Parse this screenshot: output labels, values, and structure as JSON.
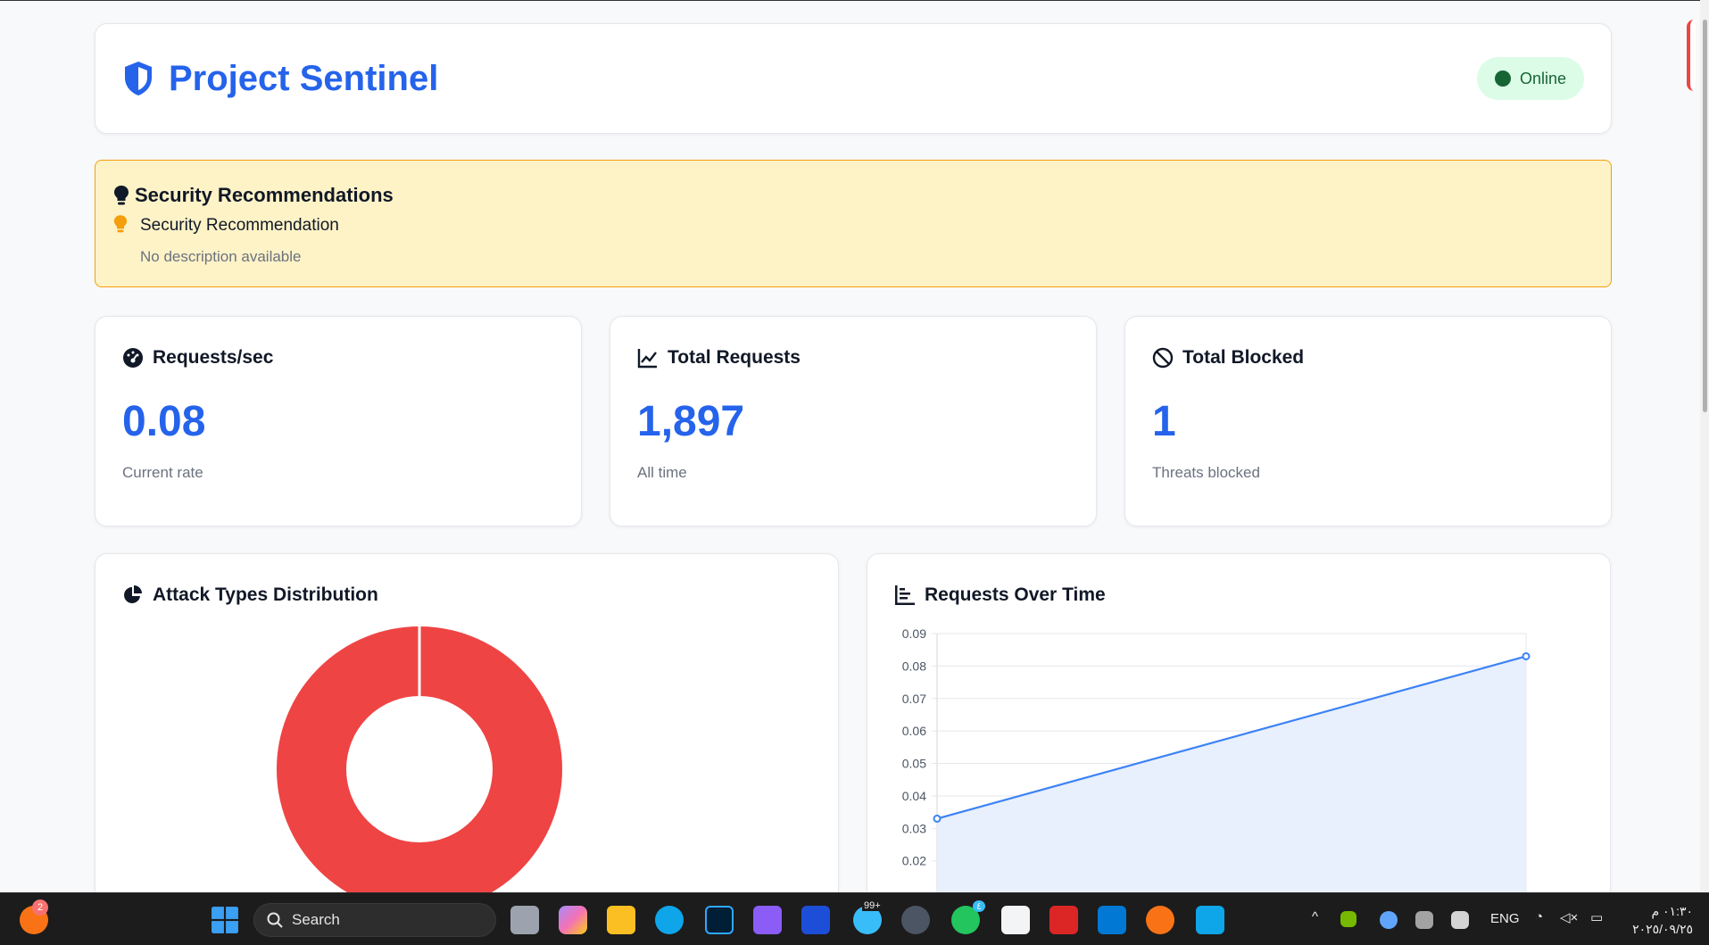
{
  "header": {
    "title": "Project Sentinel",
    "status": "Online"
  },
  "recommendations": {
    "title": "Security Recommendations",
    "items": [
      {
        "title": "Security Recommendation",
        "description": "No description available"
      }
    ]
  },
  "stats": [
    {
      "label": "Requests/sec",
      "value": "0.08",
      "sub": "Current rate",
      "icon": "gauge-icon"
    },
    {
      "label": "Total Requests",
      "value": "1,897",
      "sub": "All time",
      "icon": "line-chart-icon"
    },
    {
      "label": "Total Blocked",
      "value": "1",
      "sub": "Threats blocked",
      "icon": "ban-icon"
    }
  ],
  "charts": {
    "attack_title": "Attack Types Distribution",
    "requests_title": "Requests Over Time"
  },
  "chart_data": [
    {
      "type": "pie",
      "title": "Attack Types Distribution",
      "slices": [
        {
          "value": 1,
          "color": "#ef4444"
        }
      ]
    },
    {
      "type": "line",
      "title": "Requests Over Time",
      "x": [
        0,
        1
      ],
      "values": [
        0.033,
        0.083
      ],
      "ylim": [
        0.02,
        0.09
      ],
      "yticks": [
        "0.09",
        "0.08",
        "0.07",
        "0.06",
        "0.05",
        "0.04",
        "0.03",
        "0.02"
      ],
      "line_color": "#3b82f6",
      "fill_color": "#e8effd",
      "grid": true
    }
  ],
  "taskbar": {
    "search_placeholder": "Search",
    "badge": "2",
    "telegram_badge": "99+",
    "whatsapp_badge": "٤",
    "lang": "ENG",
    "time": "٠١:٣٠ م",
    "date": "٢٠٢٥/٠٩/٢٥"
  },
  "colors": {
    "accent": "#2563eb",
    "danger": "#ef4444",
    "success": "#166534",
    "warning_bg": "#fef3c7"
  }
}
